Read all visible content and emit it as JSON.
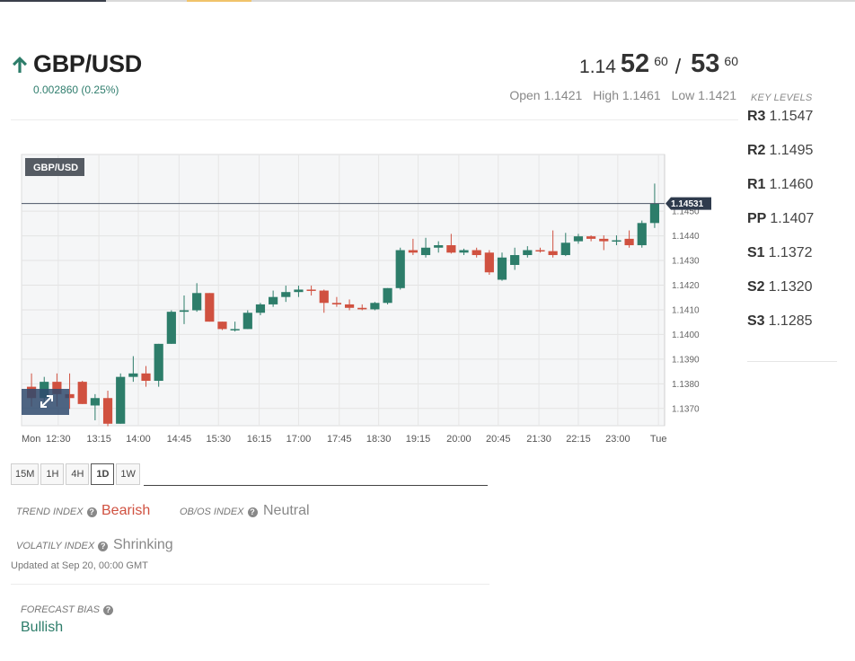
{
  "colors": {
    "bullish": "#2d7d6a",
    "bearish": "#d05140",
    "neutral": "#888888",
    "price_tag": "#2f3b4d"
  },
  "header": {
    "arrow_icon": "arrow-up-icon",
    "pair": "GBP/USD",
    "change": "0.002860 (0.25%)",
    "bid_prefix": "1.14",
    "bid_big": "52",
    "bid_sup": "60",
    "separator": "/",
    "ask_big": "53",
    "ask_sup": "60",
    "open": "Open 1.1421",
    "high": "High 1.1461",
    "low": "Low 1.1421"
  },
  "key_levels": {
    "title": "KEY LEVELS",
    "levels": [
      {
        "name": "R3",
        "value": "1.1547"
      },
      {
        "name": "R2",
        "value": "1.1495"
      },
      {
        "name": "R1",
        "value": "1.1460"
      },
      {
        "name": "PP",
        "value": "1.1407"
      },
      {
        "name": "S1",
        "value": "1.1372"
      },
      {
        "name": "S2",
        "value": "1.1320"
      },
      {
        "name": "S3",
        "value": "1.1285"
      }
    ]
  },
  "chart_data": {
    "type": "candlestick",
    "title": "GBP/USD",
    "last_price_label": "1.14531",
    "last_price": 1.14531,
    "ylim": [
      1.1363,
      1.1473
    ],
    "y_ticks": [
      "1.1450",
      "1.1440",
      "1.1430",
      "1.1420",
      "1.1410",
      "1.1400",
      "1.1390",
      "1.1380",
      "1.1370"
    ],
    "y_tick_values": [
      1.145,
      1.144,
      1.143,
      1.142,
      1.141,
      1.14,
      1.139,
      1.138,
      1.137
    ],
    "x_ticks": [
      "Mon",
      "12:30",
      "13:15",
      "14:00",
      "14:45",
      "15:30",
      "16:15",
      "17:00",
      "17:45",
      "18:30",
      "19:15",
      "20:00",
      "20:45",
      "21:30",
      "22:15",
      "23:00",
      "Tue"
    ],
    "x_tick_slots": [
      -1,
      2.1,
      5.3,
      8.4,
      11.6,
      14.7,
      17.9,
      21,
      24.2,
      27.3,
      30.4,
      33.6,
      36.7,
      39.9,
      43,
      46.1,
      49.3
    ],
    "candles": [
      {
        "o": 1.13788,
        "h": 1.13842,
        "l": 1.13708,
        "c": 1.13742
      },
      {
        "o": 1.13742,
        "h": 1.13828,
        "l": 1.13718,
        "c": 1.13808
      },
      {
        "o": 1.13808,
        "h": 1.13842,
        "l": 1.13708,
        "c": 1.13758
      },
      {
        "o": 1.13758,
        "h": 1.13842,
        "l": 1.13698,
        "c": 1.13742
      },
      {
        "o": 1.13808,
        "h": 1.13812,
        "l": 1.13718,
        "c": 1.13718
      },
      {
        "o": 1.13712,
        "h": 1.13758,
        "l": 1.13652,
        "c": 1.13742
      },
      {
        "o": 1.13742,
        "h": 1.13772,
        "l": 1.13628,
        "c": 1.13638
      },
      {
        "o": 1.13638,
        "h": 1.13842,
        "l": 1.13638,
        "c": 1.13828
      },
      {
        "o": 1.13828,
        "h": 1.13912,
        "l": 1.13808,
        "c": 1.13842
      },
      {
        "o": 1.13842,
        "h": 1.13872,
        "l": 1.13788,
        "c": 1.13812
      },
      {
        "o": 1.13812,
        "h": 1.13962,
        "l": 1.13788,
        "c": 1.13962
      },
      {
        "o": 1.13962,
        "h": 1.14098,
        "l": 1.13962,
        "c": 1.14092
      },
      {
        "o": 1.14092,
        "h": 1.14158,
        "l": 1.14042,
        "c": 1.14098
      },
      {
        "o": 1.14098,
        "h": 1.14208,
        "l": 1.14092,
        "c": 1.14168
      },
      {
        "o": 1.14168,
        "h": 1.14168,
        "l": 1.14052,
        "c": 1.14052
      },
      {
        "o": 1.14052,
        "h": 1.14052,
        "l": 1.14018,
        "c": 1.14022
      },
      {
        "o": 1.14022,
        "h": 1.14052,
        "l": 1.14012,
        "c": 1.14022
      },
      {
        "o": 1.14022,
        "h": 1.14098,
        "l": 1.14022,
        "c": 1.14088
      },
      {
        "o": 1.14088,
        "h": 1.14128,
        "l": 1.14078,
        "c": 1.14122
      },
      {
        "o": 1.14122,
        "h": 1.14178,
        "l": 1.14112,
        "c": 1.14152
      },
      {
        "o": 1.14152,
        "h": 1.14198,
        "l": 1.14132,
        "c": 1.14172
      },
      {
        "o": 1.14172,
        "h": 1.14198,
        "l": 1.14152,
        "c": 1.14182
      },
      {
        "o": 1.14182,
        "h": 1.14198,
        "l": 1.14158,
        "c": 1.14178
      },
      {
        "o": 1.14178,
        "h": 1.14182,
        "l": 1.14088,
        "c": 1.14128
      },
      {
        "o": 1.14128,
        "h": 1.14152,
        "l": 1.14112,
        "c": 1.14122
      },
      {
        "o": 1.14122,
        "h": 1.14142,
        "l": 1.14098,
        "c": 1.14108
      },
      {
        "o": 1.14108,
        "h": 1.14122,
        "l": 1.14098,
        "c": 1.14102
      },
      {
        "o": 1.14102,
        "h": 1.14132,
        "l": 1.14098,
        "c": 1.14128
      },
      {
        "o": 1.14128,
        "h": 1.14188,
        "l": 1.14122,
        "c": 1.14188
      },
      {
        "o": 1.14188,
        "h": 1.14352,
        "l": 1.14182,
        "c": 1.14342
      },
      {
        "o": 1.14342,
        "h": 1.14388,
        "l": 1.14322,
        "c": 1.14332
      },
      {
        "o": 1.14322,
        "h": 1.14392,
        "l": 1.14312,
        "c": 1.14352
      },
      {
        "o": 1.14352,
        "h": 1.14378,
        "l": 1.14332,
        "c": 1.14362
      },
      {
        "o": 1.14362,
        "h": 1.14408,
        "l": 1.14328,
        "c": 1.14332
      },
      {
        "o": 1.14332,
        "h": 1.14348,
        "l": 1.14322,
        "c": 1.14342
      },
      {
        "o": 1.14342,
        "h": 1.14352,
        "l": 1.14312,
        "c": 1.14322
      },
      {
        "o": 1.14332,
        "h": 1.14342,
        "l": 1.14242,
        "c": 1.14252
      },
      {
        "o": 1.14222,
        "h": 1.14332,
        "l": 1.14218,
        "c": 1.14312
      },
      {
        "o": 1.14282,
        "h": 1.14352,
        "l": 1.14262,
        "c": 1.14322
      },
      {
        "o": 1.14322,
        "h": 1.14358,
        "l": 1.14312,
        "c": 1.14342
      },
      {
        "o": 1.14342,
        "h": 1.14352,
        "l": 1.14332,
        "c": 1.14338
      },
      {
        "o": 1.14338,
        "h": 1.14422,
        "l": 1.14312,
        "c": 1.14322
      },
      {
        "o": 1.14322,
        "h": 1.14412,
        "l": 1.14318,
        "c": 1.14372
      },
      {
        "o": 1.14378,
        "h": 1.14408,
        "l": 1.14368,
        "c": 1.14398
      },
      {
        "o": 1.14398,
        "h": 1.14402,
        "l": 1.14378,
        "c": 1.14388
      },
      {
        "o": 1.14388,
        "h": 1.14402,
        "l": 1.14342,
        "c": 1.14378
      },
      {
        "o": 1.14378,
        "h": 1.14402,
        "l": 1.14362,
        "c": 1.14382
      },
      {
        "o": 1.14388,
        "h": 1.14422,
        "l": 1.14352,
        "c": 1.14362
      },
      {
        "o": 1.14362,
        "h": 1.14462,
        "l": 1.14352,
        "c": 1.14452
      },
      {
        "o": 1.14452,
        "h": 1.14612,
        "l": 1.14432,
        "c": 1.14531
      }
    ]
  },
  "timeframes": {
    "items": [
      "15M",
      "1H",
      "4H",
      "1D",
      "1W"
    ],
    "active": "1D"
  },
  "indicators": {
    "trend_label": "TREND INDEX",
    "trend_value": "Bearish",
    "obos_label": "OB/OS INDEX",
    "obos_value": "Neutral",
    "volatility_label": "VOLATILY INDEX",
    "volatility_value": "Shrinking",
    "updated": "Updated at Sep 20, 00:00 GMT",
    "forecast_label": "FORECAST BIAS",
    "forecast_value": "Bullish",
    "help_icon": "question-circle-icon"
  }
}
